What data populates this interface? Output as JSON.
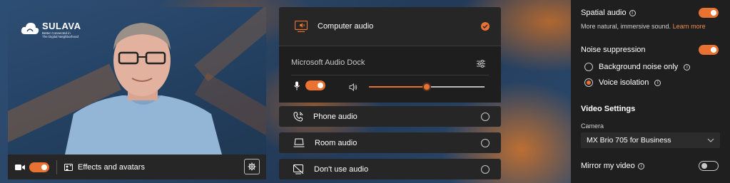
{
  "video": {
    "logo_name": "SULAVA",
    "logo_tagline_1": "Better Connected in",
    "logo_tagline_2": "The Digital Neighborhood",
    "effects_label": "Effects and avatars"
  },
  "audio": {
    "computer_audio": "Computer audio",
    "device_name": "Microsoft Audio Dock",
    "volume_level": 0.5,
    "phone_audio": "Phone audio",
    "room_audio": "Room audio",
    "no_audio": "Don't use audio"
  },
  "settings": {
    "spatial_audio": "Spatial audio",
    "spatial_desc": "More natural, immersive sound.",
    "learn_more": "Learn more",
    "noise_suppression": "Noise suppression",
    "bg_noise_only": "Background noise only",
    "voice_isolation": "Voice isolation",
    "video_settings": "Video Settings",
    "camera_label": "Camera",
    "camera_value": "MX Brio 705 for Business",
    "mirror_video": "Mirror my video"
  },
  "colors": {
    "accent": "#e97132",
    "panel_bg": "#1f1f1f",
    "card_bg": "#262626"
  }
}
